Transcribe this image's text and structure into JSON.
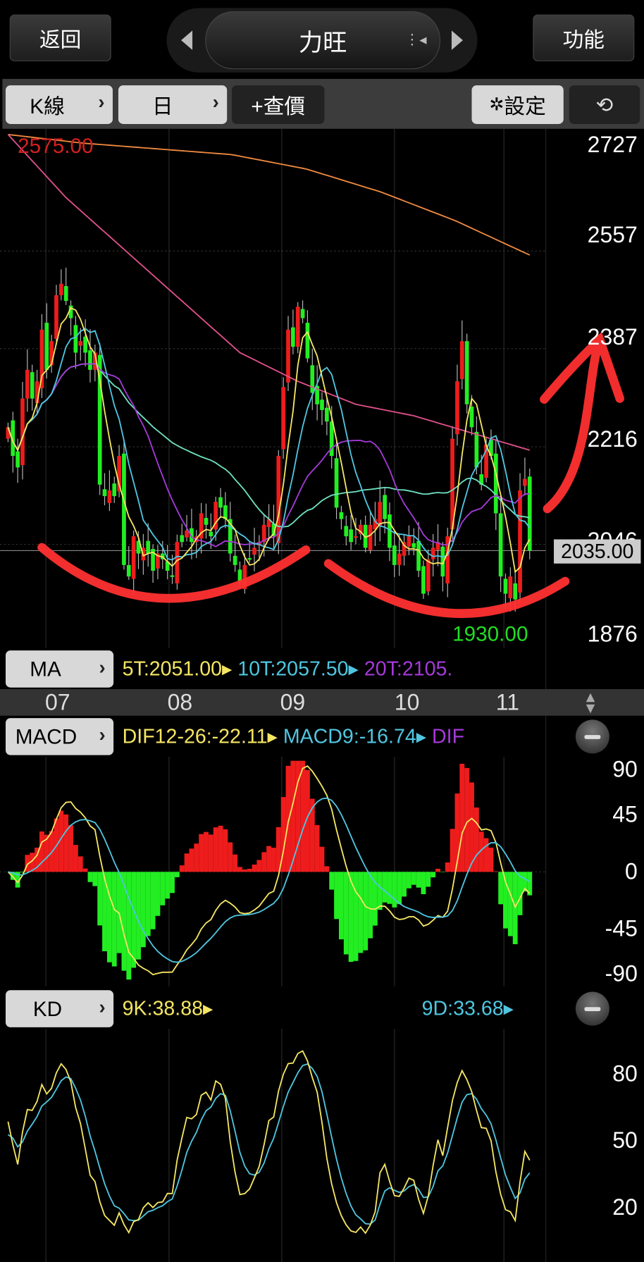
{
  "header": {
    "back_label": "返回",
    "title": "力旺",
    "function_label": "功能"
  },
  "toolbar": {
    "chart_type": "K線",
    "period": "日",
    "add_quote": "+查價",
    "settings": "設定"
  },
  "main_chart": {
    "price_axis": [
      "2727",
      "2557",
      "2387",
      "2216",
      "2046",
      "1876"
    ],
    "current_price": "2035.00",
    "high_label": "2575.00",
    "low_label": "1930.00"
  },
  "ma_legend": {
    "button": "MA",
    "ma5": "5T:2051.00",
    "ma10": "10T:2057.50",
    "ma20": "20T:2105."
  },
  "date_axis": [
    "07",
    "08",
    "09",
    "10",
    "11"
  ],
  "macd": {
    "button": "MACD",
    "dif": "DIF12-26:-22.11",
    "macd": "MACD9:-16.74",
    "osc": "DIF",
    "axis": [
      "90",
      "45",
      "0",
      "-45",
      "-90"
    ]
  },
  "kd": {
    "button": "KD",
    "k": "9K:38.88",
    "d": "9D:33.68",
    "axis": [
      "80",
      "50",
      "20"
    ]
  },
  "colors": {
    "up": "#ee1c1c",
    "down": "#22ee22",
    "ma5": "#f5e663",
    "ma10": "#4fc6e0",
    "ma20": "#a43ad8",
    "ma40": "#6fe0c0",
    "ma_long1": "#e0508a",
    "ma_long2": "#f08a40",
    "annotation": "#ff3030"
  },
  "chart_data": {
    "type": "candlestick",
    "title": "力旺 日K線",
    "x_ticks": [
      "07",
      "08",
      "09",
      "10",
      "11"
    ],
    "ylim": [
      1876,
      2727
    ],
    "closes": [
      2250,
      2200,
      2180,
      2300,
      2350,
      2300,
      2330,
      2420,
      2350,
      2400,
      2480,
      2500,
      2470,
      2440,
      2380,
      2400,
      2380,
      2350,
      2380,
      2150,
      2130,
      2140,
      2130,
      2200,
      2010,
      1990,
      2060,
      2030,
      2040,
      2030,
      2000,
      2030,
      2020,
      2000,
      1990,
      2050,
      2050,
      2070,
      2050,
      2060,
      2100,
      2080,
      2060,
      2120,
      2110,
      2090,
      2030,
      2010,
      1980,
      2010,
      2020,
      2040,
      2050,
      2080,
      2090,
      2060,
      2200,
      2320,
      2420,
      2390,
      2460,
      2440,
      2370,
      2310,
      2290,
      2280,
      2260,
      2200,
      2110,
      2090,
      2060,
      2050,
      2060,
      2080,
      2040,
      2080,
      2090,
      2120,
      2090,
      2040,
      2010,
      2030,
      2050,
      2060,
      2040,
      2000,
      1960,
      2020,
      2040,
      2050,
      1990,
      2060,
      2230,
      2330,
      2400,
      2290,
      2250,
      2180,
      2150,
      2220,
      2200,
      2100,
      1990,
      1960,
      1990,
      1950,
      2140,
      2160,
      2035
    ],
    "ma_long1": [
      2760,
      2650,
      2560,
      2470,
      2380,
      2330,
      2290,
      2270,
      2240,
      2210
    ],
    "ma_long2": [
      2760,
      2745,
      2735,
      2725,
      2700,
      2660,
      2610,
      2550
    ]
  }
}
